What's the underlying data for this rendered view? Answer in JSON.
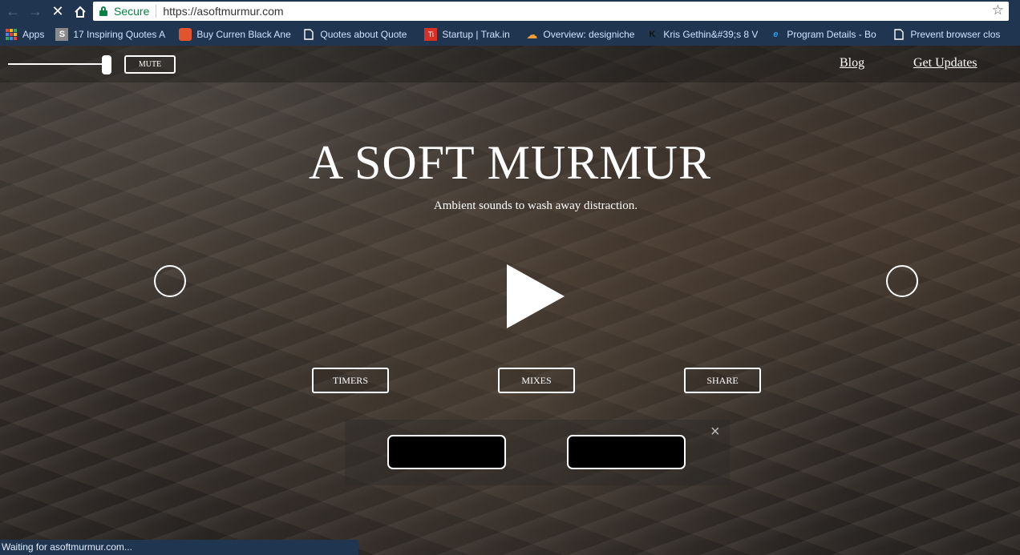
{
  "browser": {
    "back_icon": "arrow-left",
    "forward_icon": "arrow-right",
    "reload_icon": "close-x",
    "home_icon": "home",
    "secure_label": "Secure",
    "url": "https://asoftmurmur.com",
    "bookmark_star_icon": "star",
    "bookmarks": [
      {
        "label": "Apps",
        "icon": "apps-grid"
      },
      {
        "label": "17 Inspiring Quotes A",
        "icon": "s-logo"
      },
      {
        "label": "Buy Curren Black Ane",
        "icon": "shopping-bag"
      },
      {
        "label": "Quotes about Quote",
        "icon": "page"
      },
      {
        "label": "Startup | Trak.in",
        "icon": "trakin"
      },
      {
        "label": "Overview: designiche",
        "icon": "cloud"
      },
      {
        "label": "Kris Gethin&#39;s 8 V",
        "icon": "k-logo"
      },
      {
        "label": "Program Details - Bo",
        "icon": "ie-logo"
      },
      {
        "label": "Prevent browser clos",
        "icon": "page"
      }
    ],
    "status_text": "Waiting for asoftmurmur.com..."
  },
  "page": {
    "mute_label": "MUTE",
    "volume_level": 1.0,
    "nav": {
      "blog": "Blog",
      "updates": "Get Updates"
    },
    "title": "A SOFT MURMUR",
    "subtitle": "Ambient sounds to wash away distraction.",
    "play_icon": "play-triangle",
    "buttons": {
      "timers": "TIMERS",
      "mixes": "MIXES",
      "share": "SHARE"
    },
    "close_icon": "×",
    "colors": {
      "chrome": "#1f3550",
      "text": "#ffffff",
      "secure": "#0b8043"
    }
  }
}
